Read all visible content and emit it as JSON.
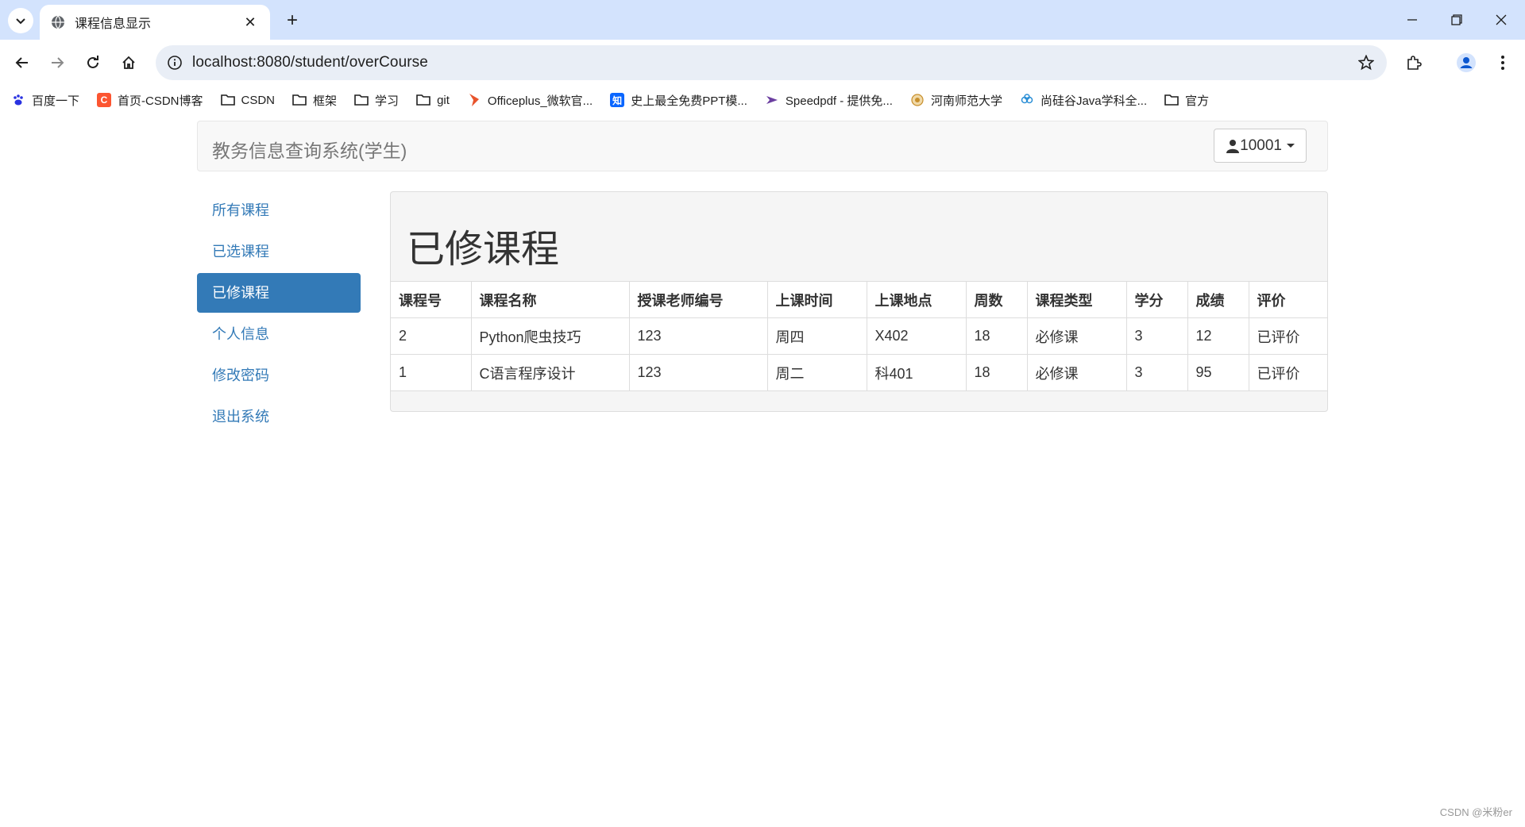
{
  "browser": {
    "tab_title": "课程信息显示",
    "url": "localhost:8080/student/overCourse",
    "bookmarks": [
      {
        "label": "百度一下",
        "icon": "baidu-icon",
        "color": "#2932e1"
      },
      {
        "label": "首页-CSDN博客",
        "icon": "csdn-icon",
        "color": "#fc5531"
      },
      {
        "label": "CSDN",
        "icon": "folder-icon"
      },
      {
        "label": "框架",
        "icon": "folder-icon"
      },
      {
        "label": "学习",
        "icon": "folder-icon"
      },
      {
        "label": "git",
        "icon": "folder-icon"
      },
      {
        "label": "Officeplus_微软官...",
        "icon": "officeplus-icon",
        "color": "#e8542c"
      },
      {
        "label": "史上最全免费PPT模...",
        "icon": "zhihu-icon",
        "color": "#0a66ff"
      },
      {
        "label": "Speedpdf - 提供免...",
        "icon": "speedpdf-icon",
        "color": "#6b3fa0"
      },
      {
        "label": "河南师范大学",
        "icon": "university-icon",
        "color": "#c8902e"
      },
      {
        "label": "尚硅谷Java学科全...",
        "icon": "atguigu-icon",
        "color": "#2b8fd6"
      },
      {
        "label": "官方",
        "icon": "folder-icon"
      }
    ]
  },
  "navbar": {
    "brand": "教务信息查询系统(学生)",
    "user": "10001"
  },
  "sidebar": {
    "items": [
      {
        "label": "所有课程",
        "active": false
      },
      {
        "label": "已选课程",
        "active": false
      },
      {
        "label": "已修课程",
        "active": true
      },
      {
        "label": "个人信息",
        "active": false
      },
      {
        "label": "修改密码",
        "active": false
      },
      {
        "label": "退出系统",
        "active": false
      }
    ]
  },
  "panel": {
    "title": "已修课程",
    "columns": [
      "课程号",
      "课程名称",
      "授课老师编号",
      "上课时间",
      "上课地点",
      "周数",
      "课程类型",
      "学分",
      "成绩",
      "评价"
    ],
    "rows": [
      [
        "2",
        "Python爬虫技巧",
        "123",
        "周四",
        "X402",
        "18",
        "必修课",
        "3",
        "12",
        "已评价"
      ],
      [
        "1",
        "C语言程序设计",
        "123",
        "周二",
        "科401",
        "18",
        "必修课",
        "3",
        "95",
        "已评价"
      ]
    ]
  },
  "watermark": "CSDN @米粉er",
  "colors": {
    "accent": "#337ab7",
    "score": "#ff0000",
    "tabstrip": "#d3e3fd"
  }
}
